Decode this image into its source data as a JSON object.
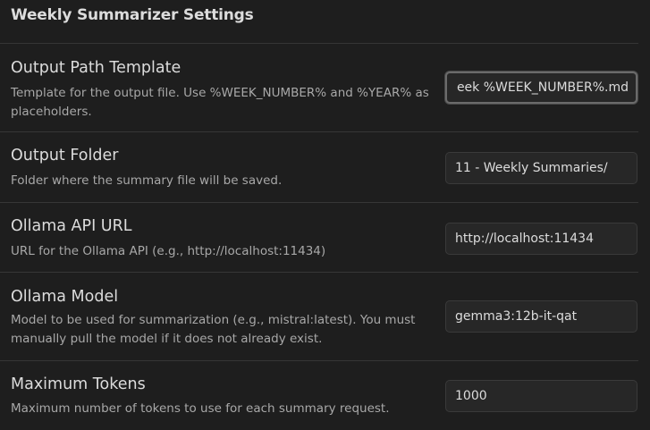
{
  "section": {
    "title": "Weekly Summarizer Settings"
  },
  "settings": [
    {
      "name": "Output Path Template",
      "description": "Template for the output file. Use %WEEK_NUMBER% and %YEAR% as placeholders.",
      "value": "eek %WEEK_NUMBER%.md"
    },
    {
      "name": "Output Folder",
      "description": "Folder where the summary file will be saved.",
      "value": "11 - Weekly Summaries/"
    },
    {
      "name": "Ollama API URL",
      "description": "URL for the Ollama API (e.g., http://localhost:11434)",
      "value": "http://localhost:11434"
    },
    {
      "name": "Ollama Model",
      "description": "Model to be used for summarization (e.g., mistral:latest). You must manually pull the model if it does not already exist.",
      "value": "gemma3:12b-it-qat"
    },
    {
      "name": "Maximum Tokens",
      "description": "Maximum number of tokens to use for each summary request.",
      "value": "1000"
    }
  ]
}
